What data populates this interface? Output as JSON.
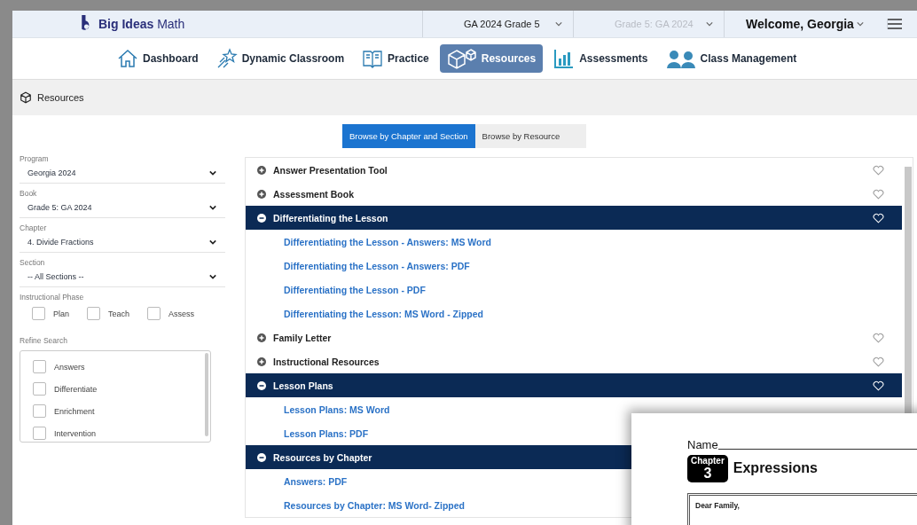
{
  "header": {
    "logo": "**Big Ideas** Math",
    "selects": [
      {
        "value": "GA 2024 Grade 5",
        "disabled": false
      },
      {
        "value": "Grade 5: GA 2024",
        "disabled": true
      }
    ],
    "welcome": "Welcome, Georgia"
  },
  "nav": [
    {
      "label": "Dashboard",
      "selected": false
    },
    {
      "label": "Dynamic Classroom",
      "selected": false
    },
    {
      "label": "Practice",
      "selected": false
    },
    {
      "label": "Resources",
      "selected": true
    },
    {
      "label": "Assessments",
      "selected": false
    },
    {
      "label": "Class Management",
      "selected": false
    }
  ],
  "breadcrumb": "Resources",
  "browse_tabs": [
    {
      "label": "Browse by Chapter and Section",
      "selected": true
    },
    {
      "label": "Browse by Resource",
      "selected": false
    }
  ],
  "filters": [
    {
      "label": "Program",
      "value": "Georgia 2024"
    },
    {
      "label": "Book",
      "value": "Grade 5: GA 2024"
    },
    {
      "label": "Chapter",
      "value": "4. Divide Fractions"
    },
    {
      "label": "Section",
      "value": "-- All Sections --"
    }
  ],
  "phase": {
    "label": "Instructional Phase",
    "options": [
      {
        "label": "Plan",
        "checked": false
      },
      {
        "label": "Teach",
        "checked": false
      },
      {
        "label": "Assess",
        "checked": false
      }
    ]
  },
  "refine": {
    "label": "Refine Search",
    "options": [
      {
        "label": "Answers",
        "checked": false
      },
      {
        "label": "Differentiate",
        "checked": false
      },
      {
        "label": "Enrichment",
        "checked": false
      },
      {
        "label": "Intervention",
        "checked": false
      }
    ]
  },
  "resources": [
    {
      "title": "Answer Presentation Tool",
      "expanded": false
    },
    {
      "title": "Assessment Book",
      "expanded": false
    },
    {
      "title": "Differentiating the Lesson",
      "expanded": true,
      "children": [
        {
          "title": "Differentiating the Lesson - Answers: MS Word"
        },
        {
          "title": "Differentiating the Lesson - Answers: PDF"
        },
        {
          "title": "Differentiating the Lesson - PDF"
        },
        {
          "title": "Differentiating the Lesson: MS Word - Zipped"
        }
      ]
    },
    {
      "title": "Family Letter",
      "expanded": false
    },
    {
      "title": "Instructional Resources",
      "expanded": false
    },
    {
      "title": "Lesson Plans",
      "expanded": true,
      "children": [
        {
          "title": "Lesson Plans: MS Word"
        },
        {
          "title": "Lesson Plans: PDF"
        }
      ]
    },
    {
      "title": "Resources by Chapter",
      "expanded": true,
      "children": [
        {
          "title": "Answers: PDF"
        },
        {
          "title": "Resources by Chapter: MS Word- Zipped"
        }
      ]
    }
  ],
  "preview": {
    "name_label": "Name",
    "chapter_word": "Chapter",
    "chapter_number": "3",
    "chapter_title": "Expressions",
    "letter_greeting": "Dear Family,"
  }
}
